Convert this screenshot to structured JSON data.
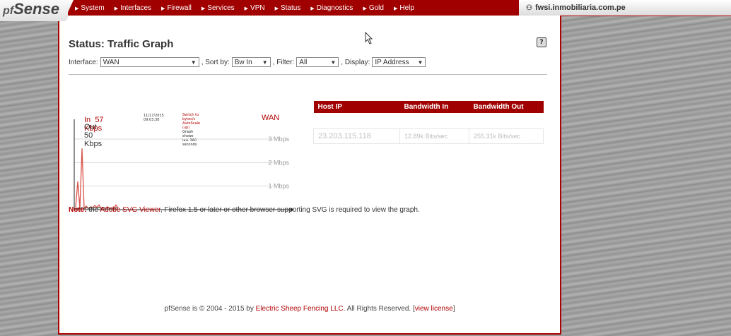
{
  "brand": {
    "logo_prefix": "pf",
    "logo_text": "Sense"
  },
  "nav": {
    "items": [
      "System",
      "Interfaces",
      "Firewall",
      "Services",
      "VPN",
      "Status",
      "Diagnostics",
      "Gold",
      "Help"
    ]
  },
  "host": {
    "name": "fwsi.inmobiliaria.com.pe"
  },
  "page": {
    "title": "Status: Traffic Graph",
    "help": "?"
  },
  "filters": {
    "interface_label": "Interface:",
    "interface_value": "WAN",
    "sort_label": ", Sort by:",
    "sort_value": "Bw In",
    "filter_label": ", Filter:",
    "filter_value": "All",
    "display_label": ", Display:",
    "display_value": "IP Address"
  },
  "graph": {
    "in_label": "In",
    "in_value": "57 Kbps",
    "out_label": "Out",
    "out_value": "50 Kbps",
    "date": "11/17/2015",
    "time": "09:03:30",
    "switch_scale": "Switch to bytes/s",
    "autoscale": "AutoScale (up)",
    "shows": "Graph shows last 360 seconds",
    "iface": "WAN",
    "y_ticks": [
      "3 Mbps",
      "2 Mbps",
      "1 Mbps"
    ],
    "colors": {
      "in": "#d9534a",
      "out": "#555555"
    }
  },
  "chart_data": {
    "type": "line",
    "ylabel": "",
    "ylim": [
      0,
      3
    ],
    "y_ticks": [
      "3 Mbps",
      "2 Mbps",
      "1 Mbps"
    ],
    "series": [
      {
        "name": "In",
        "values": [
          0.1,
          1.2,
          0.05,
          2.6,
          0.05,
          0.15,
          0.05,
          0.12,
          0.08,
          0.18,
          0.1,
          0.2,
          0.06,
          0.1,
          0.06,
          0.12,
          0.06,
          0.08,
          0.06,
          0.2,
          0.06
        ]
      },
      {
        "name": "Out",
        "values": [
          0.05,
          0.05,
          0.05,
          0.08,
          0.05,
          0.1,
          0.05,
          0.08,
          0.06,
          0.1,
          0.06,
          0.1,
          0.05,
          0.08,
          0.05,
          0.08,
          0.05,
          0.06,
          0.05,
          0.08,
          0.05
        ]
      }
    ]
  },
  "table": {
    "headers": [
      "Host IP",
      "Bandwidth In",
      "Bandwidth Out"
    ],
    "rows": [
      [
        "23.203.115.118",
        "12.89k Bits/sec",
        "255.31k Bits/sec"
      ]
    ]
  },
  "note": {
    "label": "Note:",
    "pre": "the",
    "link": "Adobe SVG Viewer",
    "post": ", Firefox 1.5 or later or other browser supporting SVG is required to view the graph."
  },
  "footer": {
    "pre": "pfSense is © 2004 - 2015 by",
    "company": "Electric Sheep Fencing LLC",
    "mid": ". All Rights Reserved. [",
    "license": "view license",
    "post": "]"
  }
}
